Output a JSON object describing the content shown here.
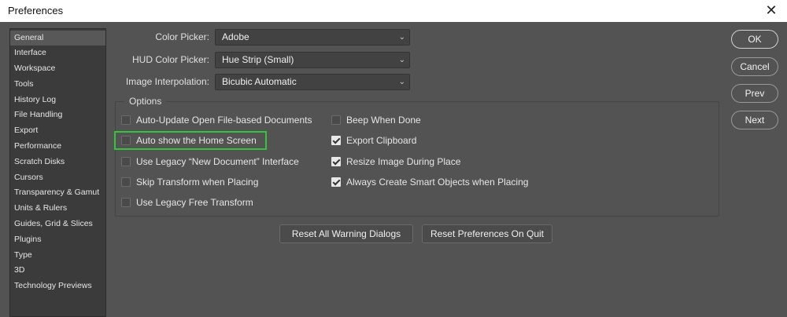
{
  "window": {
    "title": "Preferences",
    "close_glyph": "✕"
  },
  "sidebar": {
    "items": [
      {
        "label": "General"
      },
      {
        "label": "Interface"
      },
      {
        "label": "Workspace"
      },
      {
        "label": "Tools"
      },
      {
        "label": "History Log"
      },
      {
        "label": "File Handling"
      },
      {
        "label": "Export"
      },
      {
        "label": "Performance"
      },
      {
        "label": "Scratch Disks"
      },
      {
        "label": "Cursors"
      },
      {
        "label": "Transparency & Gamut"
      },
      {
        "label": "Units & Rulers"
      },
      {
        "label": "Guides, Grid & Slices"
      },
      {
        "label": "Plugins"
      },
      {
        "label": "Type"
      },
      {
        "label": "3D"
      },
      {
        "label": "Technology Previews"
      }
    ],
    "selected": "General"
  },
  "settings": {
    "color_picker": {
      "label": "Color Picker:",
      "value": "Adobe"
    },
    "hud_color_picker": {
      "label": "HUD Color Picker:",
      "value": "Hue Strip (Small)"
    },
    "image_interpolation": {
      "label": "Image Interpolation:",
      "value": "Bicubic Automatic"
    },
    "chevron": "⌄"
  },
  "options": {
    "title": "Options",
    "left": [
      {
        "label": "Auto-Update Open File-based Documents",
        "checked": false
      },
      {
        "label": "Auto show the Home Screen",
        "checked": false,
        "highlighted": true
      },
      {
        "label": "Use Legacy “New Document” Interface",
        "checked": false
      },
      {
        "label": "Skip Transform when Placing",
        "checked": false
      },
      {
        "label": "Use Legacy Free Transform",
        "checked": false
      }
    ],
    "right": [
      {
        "label": "Beep When Done",
        "checked": false
      },
      {
        "label": "Export Clipboard",
        "checked": true
      },
      {
        "label": "Resize Image During Place",
        "checked": true
      },
      {
        "label": "Always Create Smart Objects when Placing",
        "checked": true
      }
    ]
  },
  "actions": {
    "reset_warnings": "Reset All Warning Dialogs",
    "reset_prefs": "Reset Preferences On Quit"
  },
  "buttons": {
    "ok": "OK",
    "cancel": "Cancel",
    "prev": "Prev",
    "next": "Next"
  },
  "colors": {
    "background": "#535353",
    "sidebar": "#3b3b3b",
    "sidebar_selected": "#585858",
    "highlight": "#36c23a"
  }
}
